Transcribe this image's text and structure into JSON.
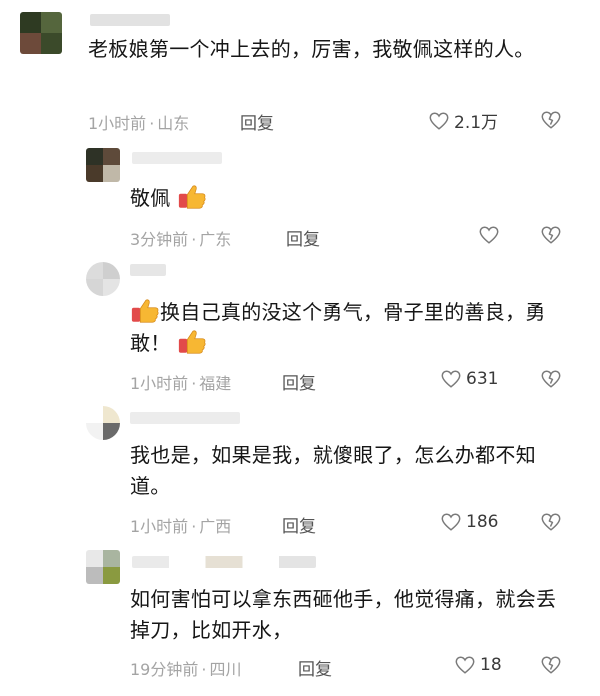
{
  "comments": [
    {
      "text": "老板娘第一个冲上去的，厉害，我敬佩这样的人。",
      "time": "1小时前",
      "location": "山东",
      "reply_label": "回复",
      "likes": "2.1万",
      "emoji_prefix": false,
      "emoji_suffix": false
    },
    {
      "text": "敬佩",
      "time": "3分钟前",
      "location": "广东",
      "reply_label": "回复",
      "likes": "",
      "emoji_prefix": false,
      "emoji_suffix": true
    },
    {
      "text": "换自己真的没这个勇气，骨子里的善良，勇敢！",
      "time": "1小时前",
      "location": "福建",
      "reply_label": "回复",
      "likes": "631",
      "emoji_prefix": true,
      "emoji_suffix": true
    },
    {
      "text": "我也是，如果是我，就傻眼了，怎么办都不知道。",
      "time": "1小时前",
      "location": "广西",
      "reply_label": "回复",
      "likes": "186",
      "emoji_prefix": false,
      "emoji_suffix": false
    },
    {
      "text": "如何害怕可以拿东西砸他手，他觉得痛，就会丢掉刀，比如开水，",
      "time": "19分钟前",
      "location": "四川",
      "reply_label": "回复",
      "likes": "18",
      "emoji_prefix": false,
      "emoji_suffix": false
    }
  ],
  "icons": {
    "like": "heart-outline-icon",
    "dislike": "broken-heart-icon",
    "emoji": "thumbs-up-emoji"
  },
  "colors": {
    "text": "#161616",
    "meta": "#a4a4a4",
    "reply": "#555555",
    "icon": "#7a7a7a"
  },
  "separator": "·"
}
